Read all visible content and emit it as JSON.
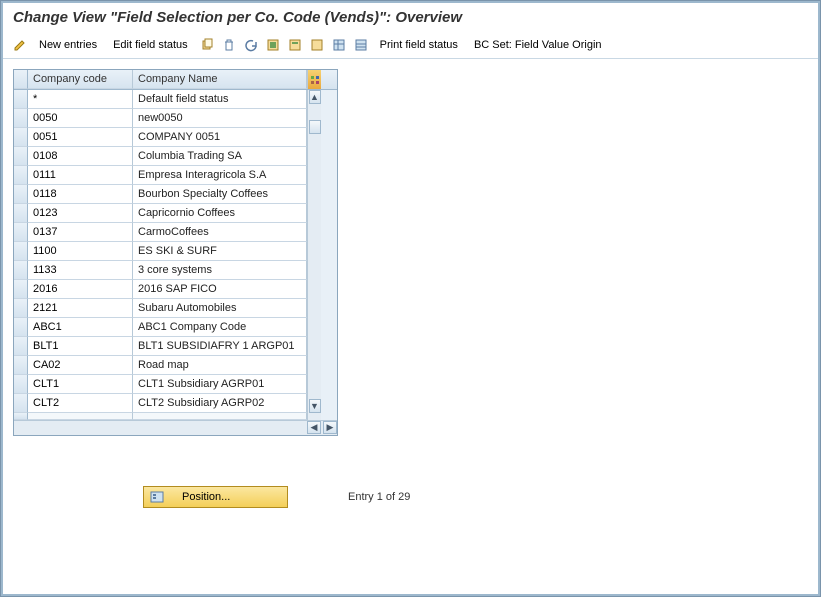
{
  "title": "Change View \"Field Selection per Co. Code (Vends)\": Overview",
  "toolbar": {
    "new_entries": "New entries",
    "edit_field_status": "Edit field status",
    "print_field_status": "Print field status",
    "bc_set": "BC Set: Field Value Origin"
  },
  "columns": {
    "code": "Company code",
    "name": "Company Name"
  },
  "rows": [
    {
      "code": "*",
      "name": "Default field status"
    },
    {
      "code": "0050",
      "name": "new0050"
    },
    {
      "code": "0051",
      "name": "COMPANY 0051"
    },
    {
      "code": "0108",
      "name": "Columbia Trading SA"
    },
    {
      "code": "0111",
      "name": "Empresa Interagricola S.A"
    },
    {
      "code": "0118",
      "name": "Bourbon Specialty Coffees"
    },
    {
      "code": "0123",
      "name": "Capricornio Coffees"
    },
    {
      "code": "0137",
      "name": "CarmoCoffees"
    },
    {
      "code": "1100",
      "name": "ES SKI & SURF"
    },
    {
      "code": "1133",
      "name": "3 core systems"
    },
    {
      "code": "2016",
      "name": "2016 SAP FICO"
    },
    {
      "code": "2121",
      "name": "Subaru Automobiles"
    },
    {
      "code": "ABC1",
      "name": "ABC1 Company Code"
    },
    {
      "code": "BLT1",
      "name": "BLT1 SUBSIDIAFRY 1 ARGP01"
    },
    {
      "code": "CA02",
      "name": "Road map"
    },
    {
      "code": "CLT1",
      "name": "CLT1 Subsidiary AGRP01"
    },
    {
      "code": "CLT2",
      "name": "CLT2 Subsidiary AGRP02"
    }
  ],
  "position_btn": "Position...",
  "entry_label": "Entry 1 of 29"
}
